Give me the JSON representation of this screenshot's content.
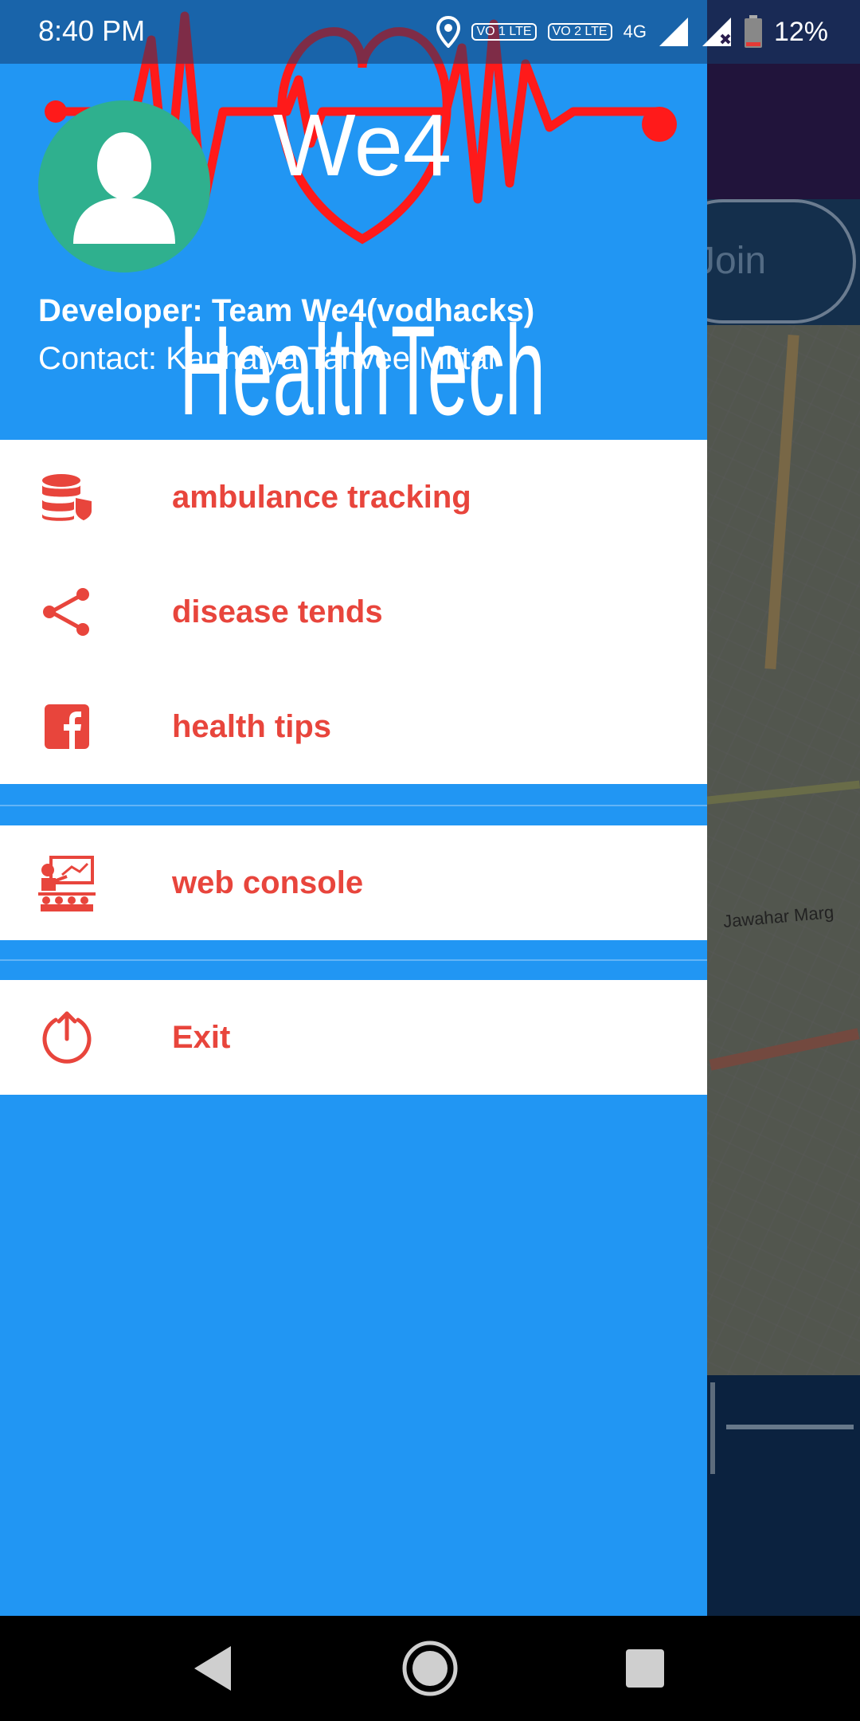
{
  "status_bar": {
    "time": "8:40 PM",
    "battery_percent": "12%",
    "sim1": "VO 1 LTE",
    "sim2": "VO 2 LTE",
    "network": "4G"
  },
  "drawer": {
    "logo": {
      "top_text": "We4",
      "bottom_text": "HealthTech"
    },
    "developer": "Developer: Team We4(vodhacks)",
    "contact": "Contact: Kanhaiya,Tanvee,Mittal",
    "menu_group_1": [
      {
        "label": "ambulance tracking",
        "icon": "database-shield-icon"
      },
      {
        "label": "disease tends",
        "icon": "share-icon"
      },
      {
        "label": "health tips",
        "icon": "facebook-icon"
      }
    ],
    "menu_group_2": [
      {
        "label": "web console",
        "icon": "presentation-icon"
      }
    ],
    "menu_group_3": [
      {
        "label": "Exit",
        "icon": "power-icon"
      }
    ]
  },
  "background": {
    "join_button": "Join",
    "map_label": "Jawahar Marg"
  },
  "colors": {
    "primary": "#2196f3",
    "menu_text": "#e8453c",
    "avatar_bg": "#2fb08e"
  }
}
